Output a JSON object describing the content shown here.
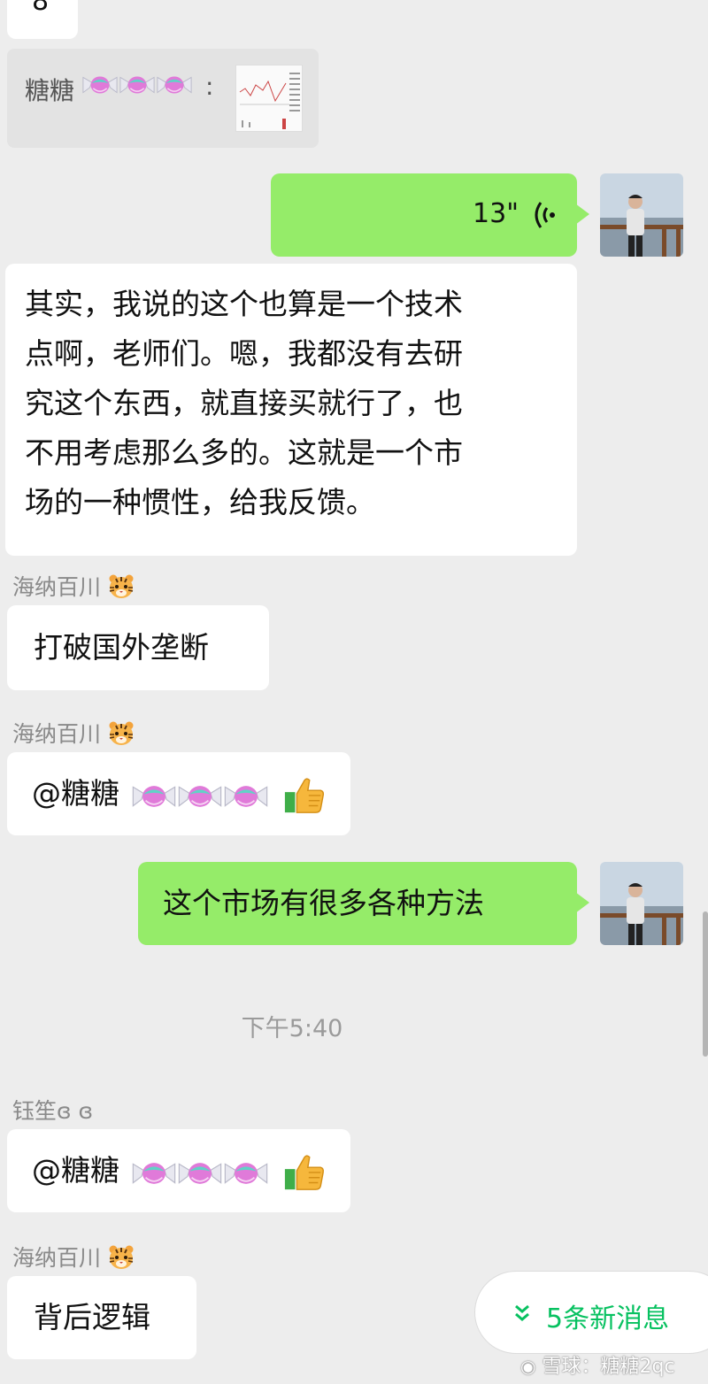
{
  "top_partial": {
    "text": "8"
  },
  "quote": {
    "sender": "糖糖",
    "candy_icons": 3,
    "colon": ":",
    "thumbnail_icon": "stock-chart-thumbnail"
  },
  "voice_message": {
    "duration": "13\"",
    "icon": "voice-wave-icon"
  },
  "long_message": {
    "lines": [
      "其实，我说的这个也算是一个技术",
      "点啊，老师们。嗯，我都没有去研",
      "究这个东西，就直接买就行了，也",
      "不用考虑那么多的。这就是一个市",
      "场的一种惯性，给我反馈。"
    ]
  },
  "messages": [
    {
      "sender": "海纳百川",
      "sender_icon": "tiger-icon",
      "text": "打破国外垄断"
    },
    {
      "sender": "海纳百川",
      "sender_icon": "tiger-icon",
      "text": "@糖糖",
      "candy_icons": 3,
      "end_icon": "thumbs-up-icon"
    },
    {
      "text": "这个市场有很多各种方法",
      "mine": true
    },
    {
      "timestamp": "下午5:40"
    },
    {
      "sender": "钰笙ɞ ɞ",
      "text": "@糖糖",
      "candy_icons": 3,
      "end_icon": "thumbs-up-icon"
    },
    {
      "sender": "海纳百川",
      "sender_icon": "tiger-icon",
      "text": "背后逻辑"
    }
  ],
  "new_messages": {
    "label": "5条新消息",
    "icon": "double-chevron-down-icon"
  },
  "watermark": {
    "text": "雪球：糖糖2qc"
  },
  "colors": {
    "mine_bubble": "#95ec69",
    "accent": "#07c160",
    "background": "#ededed"
  }
}
